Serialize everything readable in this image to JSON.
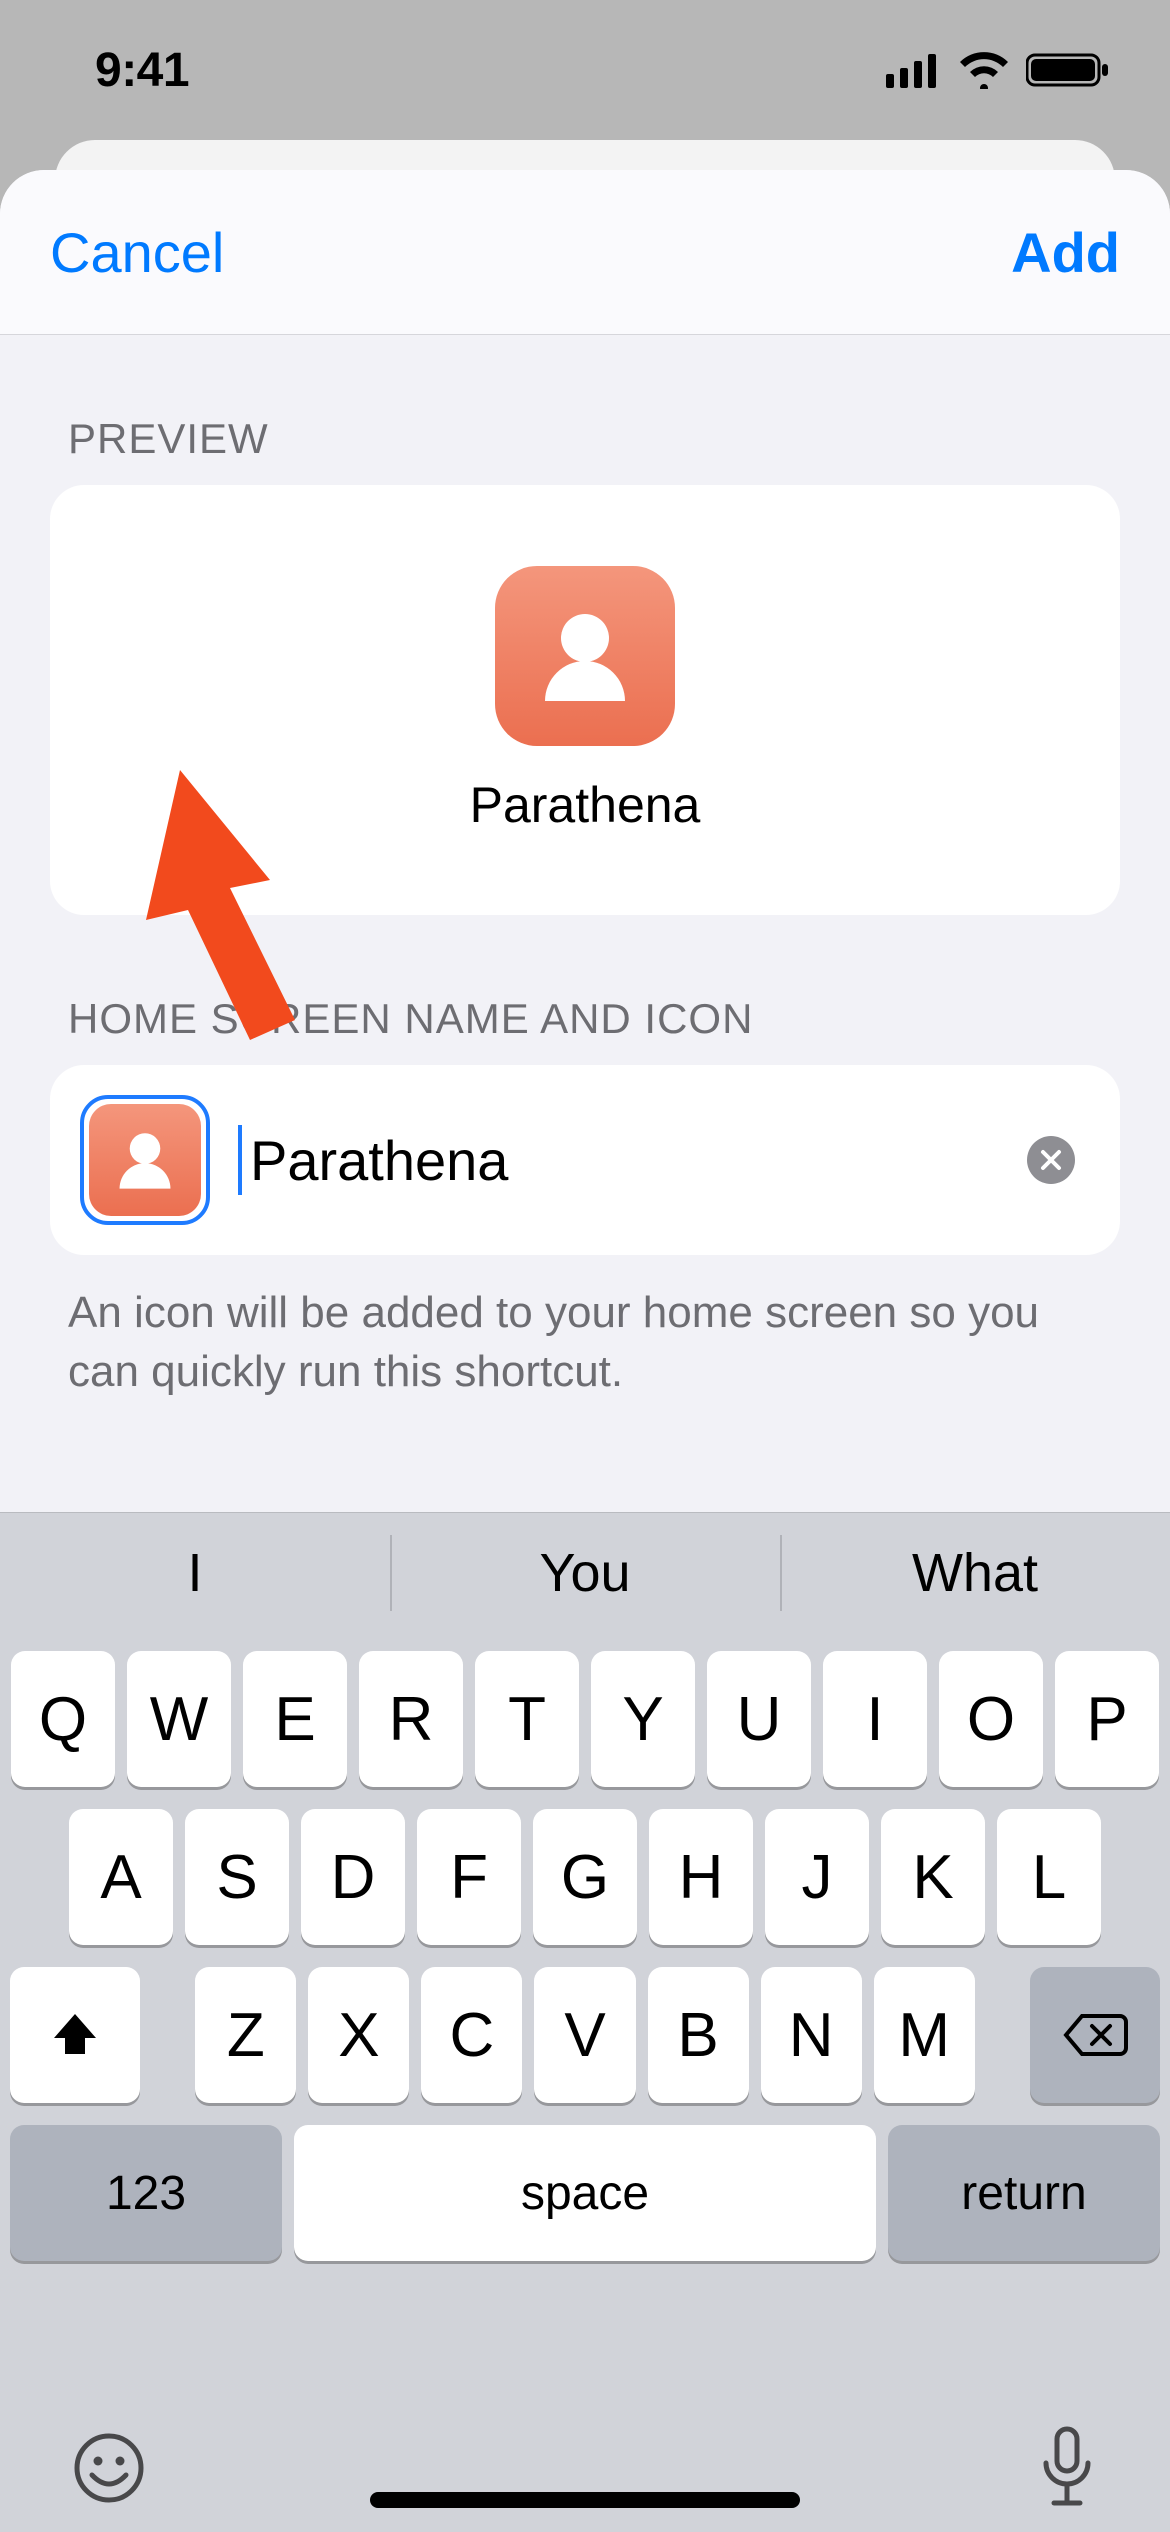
{
  "status": {
    "time": "9:41"
  },
  "nav": {
    "cancel": "Cancel",
    "add": "Add"
  },
  "sections": {
    "preview_header": "PREVIEW",
    "name_header": "HOME SCREEN NAME AND ICON"
  },
  "shortcut": {
    "name": "Parathena",
    "input_value": "Parathena",
    "icon_color": "#ec7254",
    "icon_glyph": "person"
  },
  "footer_text": "An icon will be added to your home screen so you can quickly run this shortcut.",
  "keyboard": {
    "suggestions": [
      "I",
      "You",
      "What"
    ],
    "row1": [
      "Q",
      "W",
      "E",
      "R",
      "T",
      "Y",
      "U",
      "I",
      "O",
      "P"
    ],
    "row2": [
      "A",
      "S",
      "D",
      "F",
      "G",
      "H",
      "J",
      "K",
      "L"
    ],
    "row3": [
      "Z",
      "X",
      "C",
      "V",
      "B",
      "N",
      "M"
    ],
    "nums_label": "123",
    "space_label": "space",
    "return_label": "return"
  }
}
